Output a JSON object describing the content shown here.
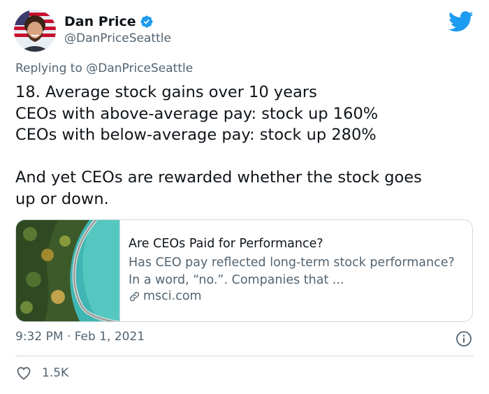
{
  "author": {
    "display_name": "Dan Price",
    "handle": "@DanPriceSeattle",
    "verified": true
  },
  "reply": {
    "prefix": "Replying to ",
    "mention": "@DanPriceSeattle"
  },
  "tweet": {
    "text": "18. Average stock gains over 10 years\nCEOs with above-average pay: stock up 160%\nCEOs with below-average pay: stock up 280%\n\nAnd yet CEOs are rewarded whether the stock goes\nup or down."
  },
  "card": {
    "title": "Are CEOs Paid for Performance?",
    "description": "Has CEO pay reflected long-term stock performance? In a word, “no.”. Companies that ...",
    "domain": "msci.com"
  },
  "meta": {
    "timestamp": "9:32 PM · Feb 1, 2021",
    "likes": "1.5K"
  },
  "colors": {
    "twitter_blue": "#1d9bf0",
    "secondary_text": "#536471",
    "border": "#cfd9de"
  },
  "icons": {
    "brand": "twitter-bird-icon",
    "verified": "verified-badge-icon",
    "link": "link-icon",
    "info": "info-icon",
    "like": "heart-icon"
  }
}
